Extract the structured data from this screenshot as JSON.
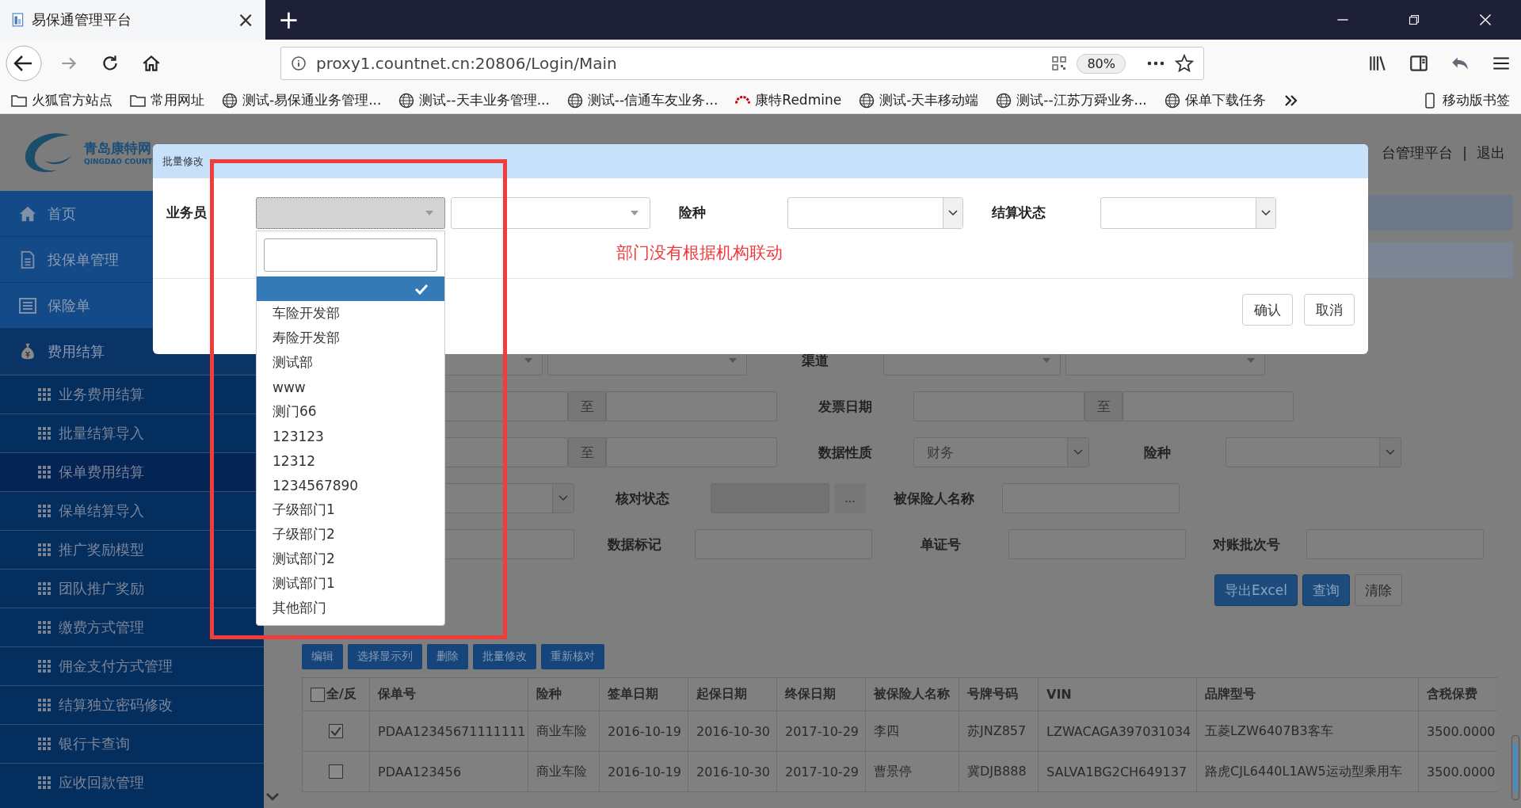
{
  "browser": {
    "tab_title": "易保通管理平台",
    "tab_close": "×",
    "new_tab": "+",
    "url": "proxy1.countnet.cn:20806/Login/Main",
    "zoom": "80%",
    "bookmarks": [
      {
        "label": "火狐官方站点",
        "kind": "folder"
      },
      {
        "label": "常用网址",
        "kind": "folder"
      },
      {
        "label": "测试-易保通业务管理...",
        "kind": "globe"
      },
      {
        "label": "测试--天丰业务管理...",
        "kind": "globe"
      },
      {
        "label": "测试--信通车友业务...",
        "kind": "globe"
      },
      {
        "label": "康特Redmine",
        "kind": "redmine"
      },
      {
        "label": "测试-天丰移动端",
        "kind": "globe"
      },
      {
        "label": "测试--江苏万舜业务...",
        "kind": "globe"
      },
      {
        "label": "保单下载任务",
        "kind": "globe"
      }
    ],
    "mobile_bookmarks": "移动版书签"
  },
  "header": {
    "logo_cn": "青岛康特网",
    "logo_en": "QINGDAO COUNT",
    "platform": "台管理平台",
    "separator": "|",
    "logout": "退出"
  },
  "sidebar": {
    "items": [
      {
        "label": "首页",
        "kind": "home",
        "expanded": false
      },
      {
        "label": "投保单管理",
        "kind": "document",
        "expanded": false
      },
      {
        "label": "保险单",
        "kind": "list",
        "expanded": false
      },
      {
        "label": "费用结算",
        "kind": "money",
        "expanded": true,
        "children": [
          {
            "label": "业务费用结算",
            "selected": false
          },
          {
            "label": "批量结算导入",
            "selected": false
          },
          {
            "label": "保单费用结算",
            "selected": true
          },
          {
            "label": "保单结算导入",
            "selected": false
          },
          {
            "label": "推广奖励模型",
            "selected": false
          },
          {
            "label": "团队推广奖励",
            "selected": false
          },
          {
            "label": "缴费方式管理",
            "selected": false
          },
          {
            "label": "佣金支付方式管理",
            "selected": false
          },
          {
            "label": "结算独立密码修改",
            "selected": false
          },
          {
            "label": "银行卡查询",
            "selected": false
          },
          {
            "label": "应收回款管理",
            "selected": false
          }
        ]
      }
    ]
  },
  "search_form": {
    "rows": [
      {
        "items": [
          {
            "kind": "select"
          },
          {
            "kind": "select"
          },
          {
            "kind": "label",
            "text": "渠道"
          },
          {
            "kind": "select"
          },
          {
            "kind": "select"
          }
        ]
      },
      {
        "items": [
          {
            "kind": "input"
          },
          {
            "kind": "to",
            "text": "至"
          },
          {
            "kind": "input"
          },
          {
            "kind": "label",
            "text": "发票日期"
          },
          {
            "kind": "input"
          },
          {
            "kind": "to",
            "text": "至"
          },
          {
            "kind": "input"
          }
        ]
      },
      {
        "items": [
          {
            "kind": "input"
          },
          {
            "kind": "to",
            "text": "至"
          },
          {
            "kind": "input"
          },
          {
            "kind": "label",
            "text": "数据性质"
          },
          {
            "kind": "combo",
            "value": "财务"
          },
          {
            "kind": "label",
            "text": "险种"
          },
          {
            "kind": "combo"
          }
        ]
      },
      {
        "items": [
          {
            "kind": "combo"
          },
          {
            "kind": "label",
            "text": "核对状态"
          },
          {
            "kind": "readonly"
          },
          {
            "kind": "ellipsis",
            "text": "..."
          },
          {
            "kind": "label",
            "text": "被保险人名称"
          },
          {
            "kind": "input"
          }
        ]
      },
      {
        "items": [
          {
            "kind": "input"
          },
          {
            "kind": "label",
            "text": "数据标记"
          },
          {
            "kind": "input"
          },
          {
            "kind": "label",
            "text": "单证号"
          },
          {
            "kind": "input"
          },
          {
            "kind": "label",
            "text": "对账批次号"
          },
          {
            "kind": "input"
          }
        ]
      }
    ],
    "buttons": [
      {
        "label": "导出Excel",
        "kind": "primary"
      },
      {
        "label": "查询",
        "kind": "primary"
      },
      {
        "label": "清除",
        "kind": "plain"
      }
    ]
  },
  "toolbar": [
    "编辑",
    "选择显示列",
    "删除",
    "批量修改",
    "重新核对"
  ],
  "table": {
    "select_all": {
      "label": "全/反",
      "checked": false
    },
    "columns": [
      "保单号",
      "险种",
      "签单日期",
      "起保日期",
      "终保日期",
      "被保险人名称",
      "号牌号码",
      "VIN",
      "品牌型号",
      "含税保费"
    ],
    "rows": [
      {
        "checked": true,
        "cells": [
          "PDAA12345671111111",
          "商业车险",
          "2016-10-19",
          "2016-10-30",
          "2017-10-29",
          "李四",
          "苏JNZ857",
          "LZWACAGA397031034",
          "五菱LZW6407B3客车",
          "3500.0000"
        ]
      },
      {
        "checked": false,
        "cells": [
          "PDAA123456",
          "商业车险",
          "2016-10-19",
          "2016-10-30",
          "2017-10-29",
          "曹景停",
          "冀DJB888",
          "SALVA1BG2CH649137",
          "路虎CJL6440L1AW5运动型乘用车",
          "3500.0000"
        ]
      }
    ]
  },
  "modal": {
    "title": "批量修改",
    "fields": [
      {
        "label": "业务员"
      },
      {
        "label": "险种"
      },
      {
        "label": "结算状态"
      }
    ],
    "note": "部门没有根据机构联动",
    "dropdown": {
      "options": [
        {
          "selected": true
        },
        {
          "label": "车险开发部",
          "selected": false
        },
        {
          "label": "寿险开发部",
          "selected": false
        },
        {
          "label": "测试部",
          "selected": false
        },
        {
          "label": "www",
          "selected": false
        },
        {
          "label": "测门66",
          "selected": false
        },
        {
          "label": "123123",
          "selected": false
        },
        {
          "label": "12312",
          "selected": false
        },
        {
          "label": "1234567890",
          "selected": false
        },
        {
          "label": "子级部门1",
          "selected": false
        },
        {
          "label": "子级部门2",
          "selected": false
        },
        {
          "label": "测试部门2",
          "selected": false
        },
        {
          "label": "测试部门1",
          "selected": false
        },
        {
          "label": "其他部门",
          "selected": false
        }
      ]
    },
    "buttons": [
      "确认",
      "取消"
    ]
  }
}
